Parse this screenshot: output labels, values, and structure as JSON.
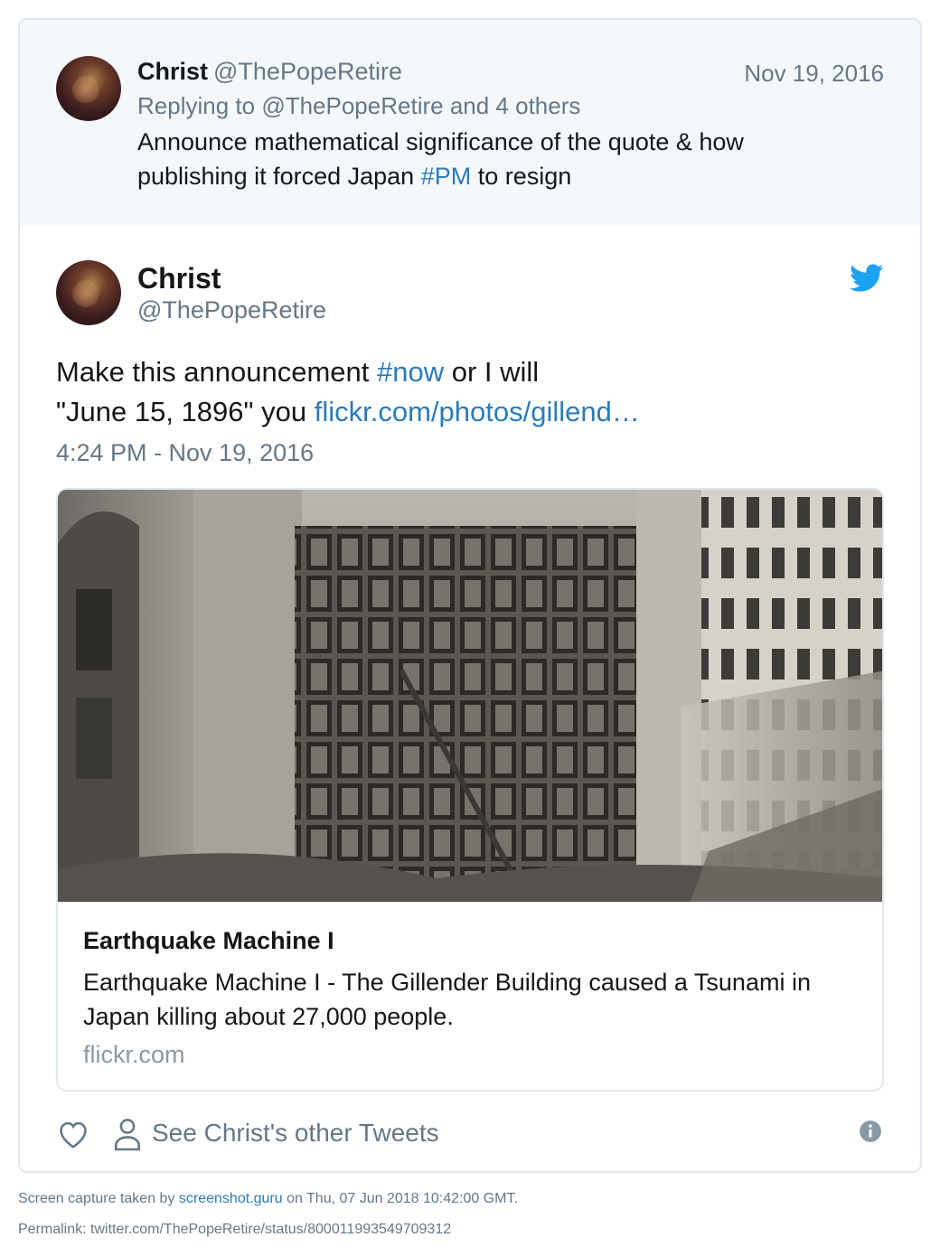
{
  "parent_tweet": {
    "name": "Christ",
    "handle": "@ThePopeRetire",
    "date": "Nov 19, 2016",
    "replying_prefix": "Replying to ",
    "replying_handle": "@ThePopeRetire",
    "replying_suffix": " and 4 others",
    "text_before": "Announce mathematical significance of the quote & how publishing it forced Japan ",
    "hashtag": "#PM",
    "text_after": " to resign"
  },
  "main_tweet": {
    "name": "Christ",
    "handle": "@ThePopeRetire",
    "text_before": "Make this announcement ",
    "hashtag": "#now",
    "text_middle": " or I will",
    "text_line2": "\"June 15, 1896\" you ",
    "link": "flickr.com/photos/gillend…",
    "timestamp": "4:24 PM - Nov 19, 2016"
  },
  "card": {
    "title": "Earthquake Machine I",
    "description": "Earthquake Machine I - The Gillender Building caused a Tsunami in Japan killing about 27,000 people.",
    "domain": "flickr.com"
  },
  "actions": {
    "see_other": "See Christ's other Tweets"
  },
  "footer": {
    "capture_prefix": "Screen capture taken by ",
    "capture_site": "screenshot.guru",
    "capture_suffix": " on Thu, 07 Jun 2018 10:42:00 GMT.",
    "permalink": "Permalink: twitter.com/ThePopeRetire/status/800011993549709312"
  },
  "colors": {
    "link": "#2b7bb9",
    "twitter_blue": "#1da1f2",
    "muted": "#657786",
    "parent_bg": "#f5f8fa"
  },
  "icons": [
    "twitter-bird-icon",
    "heart-icon",
    "person-icon",
    "info-icon"
  ]
}
